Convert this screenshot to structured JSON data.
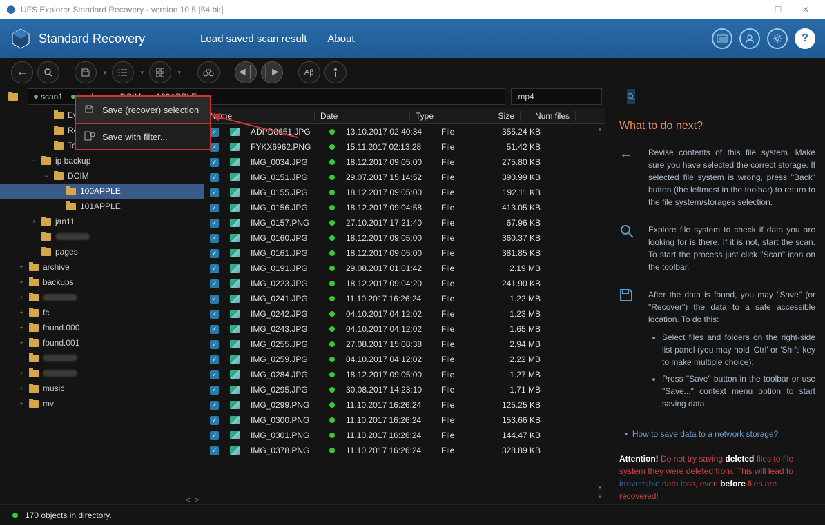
{
  "window": {
    "title": "UFS Explorer Standard Recovery - version 10.5 [64 bit]"
  },
  "header": {
    "product": "Standard Recovery",
    "menu": [
      "Load saved scan result",
      "About"
    ]
  },
  "context_menu": {
    "items": [
      {
        "label": "Save (recover) selection"
      },
      {
        "label": "Save with filter..."
      }
    ]
  },
  "breadcrumbs": [
    "scan1",
    "backup",
    "DCIM",
    "100APPLE"
  ],
  "search": {
    "value": ".mp4"
  },
  "tree": [
    {
      "indent": 3,
      "label": "Evern",
      "exp": ""
    },
    {
      "indent": 3,
      "label": "Resou",
      "exp": ""
    },
    {
      "indent": 3,
      "label": "Today",
      "exp": ""
    },
    {
      "indent": 2,
      "label": "ip backup",
      "exp": "−"
    },
    {
      "indent": 3,
      "label": "DCIM",
      "exp": "−"
    },
    {
      "indent": 4,
      "label": "100APPLE",
      "exp": "",
      "selected": true
    },
    {
      "indent": 4,
      "label": "101APPLE",
      "exp": ""
    },
    {
      "indent": 2,
      "label": "jan11",
      "exp": "+"
    },
    {
      "indent": 2,
      "label": "",
      "exp": "",
      "blurred": true
    },
    {
      "indent": 2,
      "label": "pages",
      "exp": ""
    },
    {
      "indent": 1,
      "label": "archive",
      "exp": "+"
    },
    {
      "indent": 1,
      "label": "backups",
      "exp": "+"
    },
    {
      "indent": 1,
      "label": "",
      "exp": "+",
      "blurred": true
    },
    {
      "indent": 1,
      "label": "fc",
      "exp": "+"
    },
    {
      "indent": 1,
      "label": "found.000",
      "exp": "+"
    },
    {
      "indent": 1,
      "label": "found.001",
      "exp": "+"
    },
    {
      "indent": 1,
      "label": "",
      "exp": "",
      "blurred": true
    },
    {
      "indent": 1,
      "label": "",
      "exp": "+",
      "blurred": true
    },
    {
      "indent": 1,
      "label": "music",
      "exp": "+"
    },
    {
      "indent": 1,
      "label": "mv",
      "exp": "+"
    }
  ],
  "columns": {
    "name": "Name",
    "date": "Date",
    "type": "Type",
    "size": "Size",
    "num": "Num files"
  },
  "files": [
    {
      "name": "ADPD8651.JPG",
      "date": "13.10.2017 02:40:34",
      "type": "File",
      "size": "355.24 KB"
    },
    {
      "name": "FYKX6962.PNG",
      "date": "15.11.2017 02:13:28",
      "type": "File",
      "size": "51.42 KB"
    },
    {
      "name": "IMG_0034.JPG",
      "date": "18.12.2017 09:05:00",
      "type": "File",
      "size": "275.80 KB"
    },
    {
      "name": "IMG_0151.JPG",
      "date": "29.07.2017 15:14:52",
      "type": "File",
      "size": "390.99 KB"
    },
    {
      "name": "IMG_0155.JPG",
      "date": "18.12.2017 09:05:00",
      "type": "File",
      "size": "192.11 KB"
    },
    {
      "name": "IMG_0156.JPG",
      "date": "18.12.2017 09:04:58",
      "type": "File",
      "size": "413.05 KB"
    },
    {
      "name": "IMG_0157.PNG",
      "date": "27.10.2017 17:21:40",
      "type": "File",
      "size": "67.96 KB"
    },
    {
      "name": "IMG_0160.JPG",
      "date": "18.12.2017 09:05:00",
      "type": "File",
      "size": "360.37 KB"
    },
    {
      "name": "IMG_0161.JPG",
      "date": "18.12.2017 09:05:00",
      "type": "File",
      "size": "381.85 KB"
    },
    {
      "name": "IMG_0191.JPG",
      "date": "29.08.2017 01:01:42",
      "type": "File",
      "size": "2.19 MB"
    },
    {
      "name": "IMG_0223.JPG",
      "date": "18.12.2017 09:04:20",
      "type": "File",
      "size": "241.90 KB"
    },
    {
      "name": "IMG_0241.JPG",
      "date": "11.10.2017 16:26:24",
      "type": "File",
      "size": "1.22 MB"
    },
    {
      "name": "IMG_0242.JPG",
      "date": "04.10.2017 04:12:02",
      "type": "File",
      "size": "1.23 MB"
    },
    {
      "name": "IMG_0243.JPG",
      "date": "04.10.2017 04:12:02",
      "type": "File",
      "size": "1.65 MB"
    },
    {
      "name": "IMG_0255.JPG",
      "date": "27.08.2017 15:08:38",
      "type": "File",
      "size": "2.94 MB"
    },
    {
      "name": "IMG_0259.JPG",
      "date": "04.10.2017 04:12:02",
      "type": "File",
      "size": "2.22 MB"
    },
    {
      "name": "IMG_0284.JPG",
      "date": "18.12.2017 09:05:00",
      "type": "File",
      "size": "1.27 MB"
    },
    {
      "name": "IMG_0295.JPG",
      "date": "30.08.2017 14:23:10",
      "type": "File",
      "size": "1.71 MB"
    },
    {
      "name": "IMG_0299.PNG",
      "date": "11.10.2017 16:26:24",
      "type": "File",
      "size": "125.25 KB"
    },
    {
      "name": "IMG_0300.PNG",
      "date": "11.10.2017 16:26:24",
      "type": "File",
      "size": "153.66 KB"
    },
    {
      "name": "IMG_0301.PNG",
      "date": "11.10.2017 16:26:24",
      "type": "File",
      "size": "144.47 KB"
    },
    {
      "name": "IMG_0378.PNG",
      "date": "11.10.2017 16:26:24",
      "type": "File",
      "size": "328.89 KB"
    }
  ],
  "help": {
    "title": "What to do next?",
    "step1": "Revise contents of this file system. Make sure you have selected the correct storage. If selected file system is wrong, press \"Back\" button (the leftmost in the toolbar) to return to the file system/storages selection.",
    "step2": "Explore file system to check if data you are looking for is there. If it is not, start the scan. To start the process just click \"Scan\" icon on the toolbar.",
    "step3": "After the data is found, you may \"Save\" (or \"Recover\") the data to a safe accessible location. To do this:",
    "bullets": [
      "Select files and folders on the right-side list panel (you may hold 'Ctrl' or 'Shift' key to make multiple choice);",
      "Press \"Save\" button in the toolbar or use \"Save...\" context menu option to start saving data."
    ],
    "link": "How to save data to a network storage?",
    "attention_label": "Attention!",
    "attention_1": " Do not try saving ",
    "attention_deleted": "deleted",
    "attention_2": " files to file system they were deleted from. This will lead to ",
    "attention_irr": "irreversible",
    "attention_3": " data loss, even ",
    "attention_before": "before",
    "attention_4": " files are recovered!"
  },
  "status": {
    "text": "170 objects in directory."
  }
}
